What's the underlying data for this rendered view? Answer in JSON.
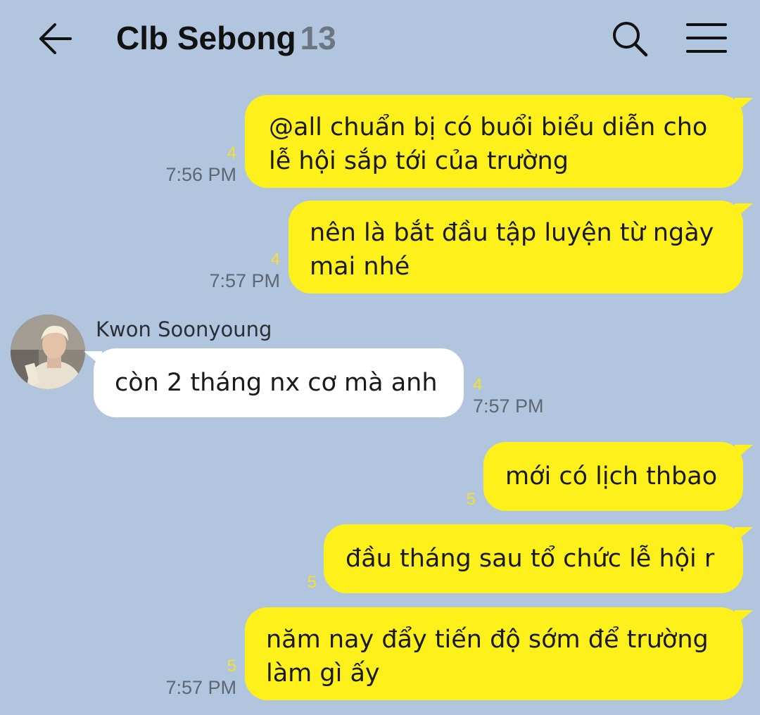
{
  "header": {
    "title": "Clb Sebong",
    "member_count": "13",
    "back_icon": "arrow-left-icon",
    "search_icon": "search-icon",
    "menu_icon": "hamburger-menu-icon"
  },
  "colors": {
    "background": "#b1c6de",
    "my_bubble": "#fef01b",
    "other_bubble": "#ffffff",
    "unread_count": "#f4e030",
    "timestamp": "#5d6672"
  },
  "messages": [
    {
      "sender": "me",
      "lines": [
        "@all chuẩn bị có buổi biểu diễn cho",
        "lễ hội sắp tới của trường"
      ],
      "unread": "4",
      "time": "7:56 PM"
    },
    {
      "sender": "me",
      "lines": [
        "nên là bắt đầu tập luyện từ ngày",
        "mai nhé"
      ],
      "unread": "4",
      "time": "7:57 PM"
    },
    {
      "sender": "Kwon Soonyoung",
      "lines": [
        "còn 2 tháng nx cơ mà anh"
      ],
      "unread": "4",
      "time": "7:57 PM"
    },
    {
      "sender": "me",
      "lines": [
        "mới có lịch thbao"
      ],
      "unread": "5",
      "time": ""
    },
    {
      "sender": "me",
      "lines": [
        "đầu tháng sau tổ chức lễ hội r"
      ],
      "unread": "5",
      "time": ""
    },
    {
      "sender": "me",
      "lines": [
        "năm nay đẩy tiến độ sớm để trường",
        "làm gì ấy"
      ],
      "unread": "5",
      "time": "7:57 PM"
    }
  ],
  "avatar_icon": "profile-photo-avatar"
}
